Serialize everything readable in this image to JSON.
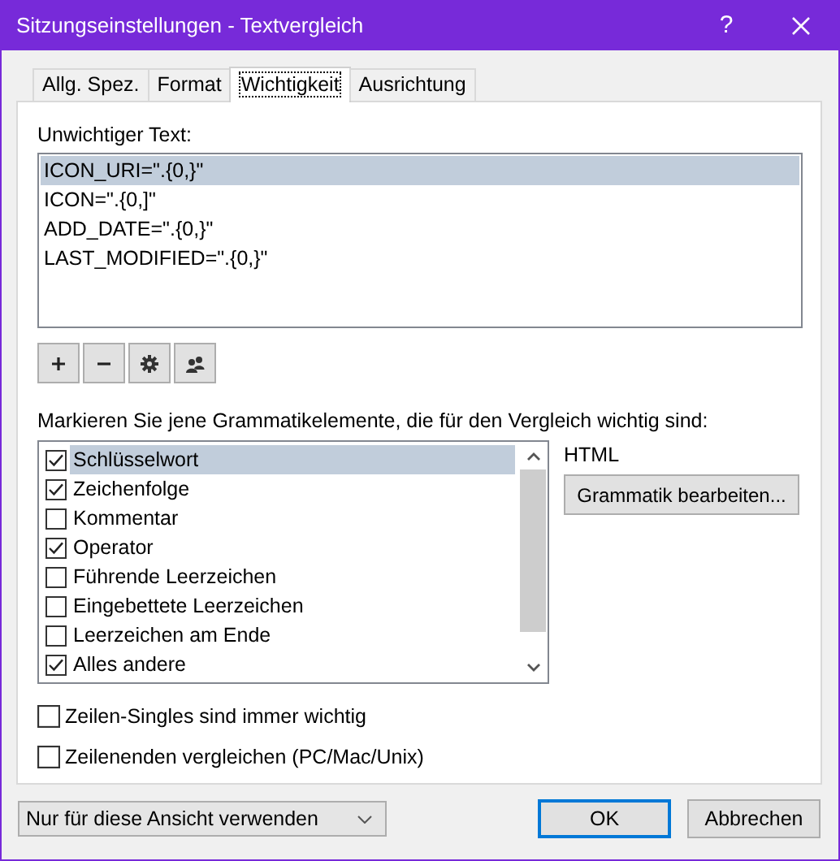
{
  "window": {
    "title": "Sitzungseinstellungen - Textvergleich",
    "help": "?"
  },
  "tabs": [
    {
      "label": "Allg. Spez.",
      "selected": false
    },
    {
      "label": "Format",
      "selected": false
    },
    {
      "label": "Wichtigkeit",
      "selected": true
    },
    {
      "label": "Ausrichtung",
      "selected": false
    }
  ],
  "unimportant_text": {
    "label": "Unwichtiger Text:",
    "items": [
      {
        "text": "ICON_URI=\".{0,}\"",
        "selected": true
      },
      {
        "text": "ICON=\".{0,]\"",
        "selected": false
      },
      {
        "text": "ADD_DATE=\".{0,}\"",
        "selected": false
      },
      {
        "text": "LAST_MODIFIED=\".{0,}\"",
        "selected": false
      }
    ]
  },
  "grammar": {
    "label": "Markieren Sie jene Grammatikelemente, die für den Vergleich wichtig sind:",
    "items": [
      {
        "label": "Schlüsselwort",
        "checked": true,
        "selected": true
      },
      {
        "label": "Zeichenfolge",
        "checked": true,
        "selected": false
      },
      {
        "label": "Kommentar",
        "checked": false,
        "selected": false
      },
      {
        "label": "Operator",
        "checked": true,
        "selected": false
      },
      {
        "label": "Führende Leerzeichen",
        "checked": false,
        "selected": false
      },
      {
        "label": "Eingebettete Leerzeichen",
        "checked": false,
        "selected": false
      },
      {
        "label": "Leerzeichen am Ende",
        "checked": false,
        "selected": false
      },
      {
        "label": "Alles andere",
        "checked": true,
        "selected": false
      }
    ],
    "language": "HTML",
    "edit_button": "Grammatik bearbeiten..."
  },
  "options": [
    {
      "label": "Zeilen-Singles sind immer wichtig",
      "checked": false
    },
    {
      "label": "Zeilenenden vergleichen (PC/Mac/Unix)",
      "checked": false
    }
  ],
  "footer": {
    "scope": {
      "value": "Nur für diese Ansicht verwenden"
    },
    "buttons": [
      {
        "label": "OK",
        "default": true
      },
      {
        "label": "Abbrechen",
        "default": false
      }
    ]
  }
}
